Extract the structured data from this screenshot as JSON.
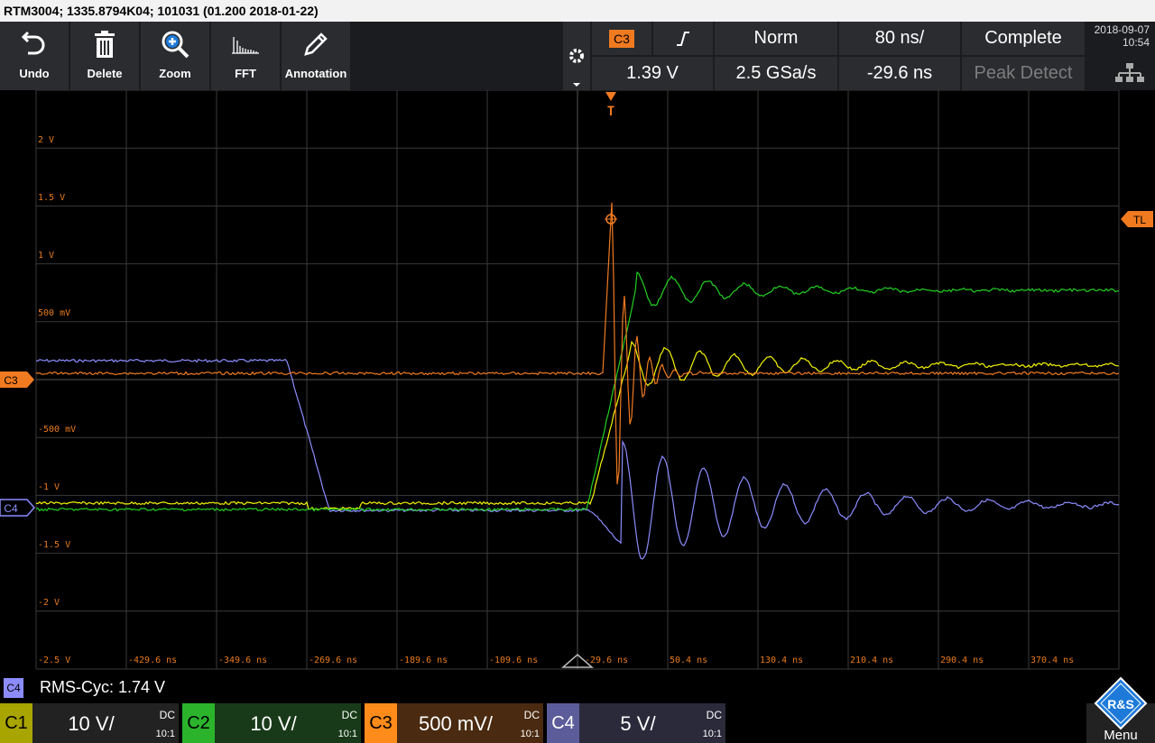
{
  "title": "RTM3004; 1335.8794K04; 101031 (01.200 2018-01-22)",
  "toolbar": {
    "undo": "Undo",
    "delete": "Delete",
    "zoom": "Zoom",
    "fft": "FFT",
    "annotation": "Annotation"
  },
  "status": {
    "trigger_channel": "C3",
    "trigger_slope_icon": "rising-edge-icon",
    "mode": "Norm",
    "timebase": "80 ns/",
    "acq_state": "Complete",
    "trigger_level": "1.39 V",
    "sample_rate": "2.5 GSa/s",
    "position": "-29.6 ns",
    "acq_mode": "Peak Detect",
    "date": "2018-09-07",
    "time": "10:54"
  },
  "screen": {
    "trigger_marker": "T",
    "trigger_level_marker": "TL",
    "ch3_marker": "C3",
    "ch4_marker": "C4",
    "y_labels": [
      "2 V",
      "1.5 V",
      "1 V",
      "500 mV",
      "-500 mV",
      "-1 V",
      "-1.5 V",
      "-2 V",
      "-2.5 V"
    ],
    "x_labels": [
      "-429.6 ns",
      "-349.6 ns",
      "-269.6 ns",
      "-189.6 ns",
      "-109.6 ns",
      "-29.6 ns",
      "50.4 ns",
      "130.4 ns",
      "210.4 ns",
      "290.4 ns",
      "370.4 ns"
    ]
  },
  "measurement": {
    "channel": "C4",
    "text": "RMS-Cyc: 1.74 V"
  },
  "channels": [
    {
      "name": "C1",
      "scale": "10 V/",
      "coupling": "DC",
      "probe": "10:1",
      "color": "#a8a400"
    },
    {
      "name": "C2",
      "scale": "10 V/",
      "coupling": "DC",
      "probe": "10:1",
      "color": "#2bb42b"
    },
    {
      "name": "C3",
      "scale": "500 mV/",
      "coupling": "DC",
      "probe": "10:1",
      "color": "#ff8c1a"
    },
    {
      "name": "C4",
      "scale": "5 V/",
      "coupling": "DC",
      "probe": "10:1",
      "color": "#8f8fd6"
    }
  ],
  "menu_label": "Menu",
  "logo_text": "R&S",
  "colors": {
    "ch1": "#f4f400",
    "ch2": "#22d022",
    "ch3": "#f07a20",
    "ch4": "#8c8cff",
    "label": "#e87a1c"
  }
}
